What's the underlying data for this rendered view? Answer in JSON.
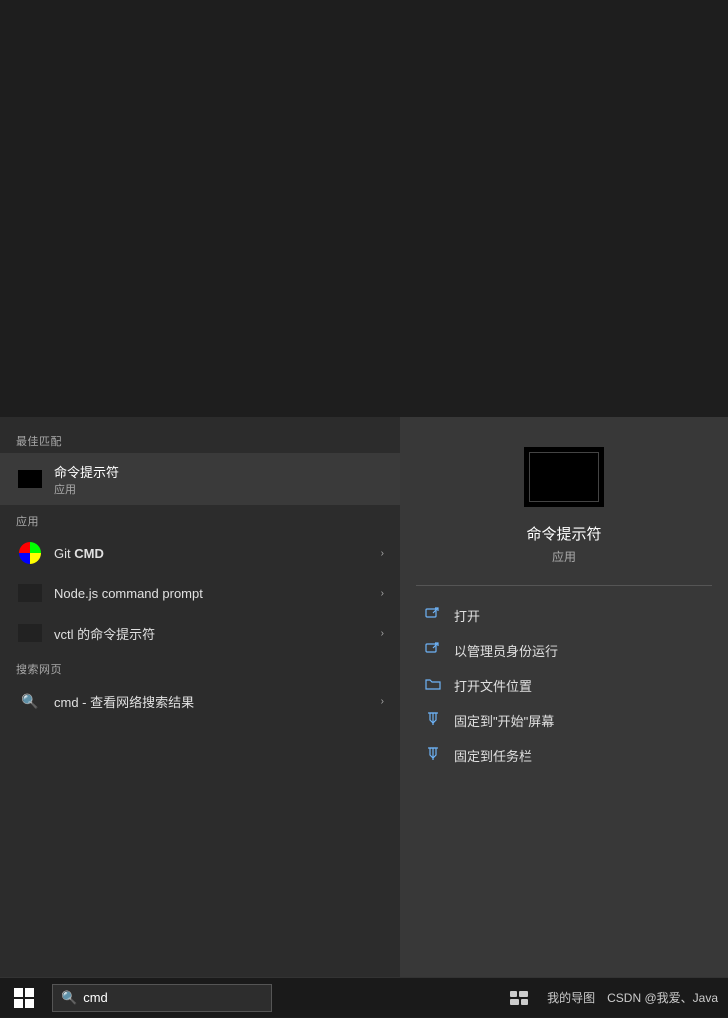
{
  "editor": {
    "background": "#1e1e1e"
  },
  "taskbar": {
    "start_label": "⊞",
    "search_placeholder": "cmd",
    "search_text": "cmd",
    "icons": [
      {
        "name": "task-view-icon",
        "symbol": "⧉"
      },
      {
        "name": "my-guide-label",
        "text": "我的导图"
      },
      {
        "name": "csdn-label",
        "text": "CSDN @我爱、Java"
      }
    ]
  },
  "start_menu": {
    "best_match_section": "最佳匹配",
    "best_match_item": {
      "name": "命令提示符",
      "type": "应用"
    },
    "apps_section": "应用",
    "apps": [
      {
        "id": "git-cmd",
        "name": "Git CMD",
        "bold_part": "CMD",
        "has_arrow": true
      },
      {
        "id": "nodejs-prompt",
        "name": "Node.js command prompt",
        "has_arrow": true
      },
      {
        "id": "vctl-cmd",
        "name": "vctl 的命令提示符",
        "has_arrow": true
      }
    ],
    "web_section": "搜索网页",
    "web_items": [
      {
        "id": "cmd-search",
        "name": "cmd - 查看网络搜索结果",
        "has_arrow": true
      }
    ],
    "right_panel": {
      "app_name": "命令提示符",
      "app_type": "应用",
      "actions": [
        {
          "id": "open",
          "label": "打开",
          "icon": "↗"
        },
        {
          "id": "run-as-admin",
          "label": "以管理员身份运行",
          "icon": "⊞"
        },
        {
          "id": "open-location",
          "label": "打开文件位置",
          "icon": "📁"
        },
        {
          "id": "pin-start",
          "label": "固定到\"开始\"屏幕",
          "icon": "📌"
        },
        {
          "id": "pin-taskbar",
          "label": "固定到任务栏",
          "icon": "📌"
        }
      ]
    }
  }
}
